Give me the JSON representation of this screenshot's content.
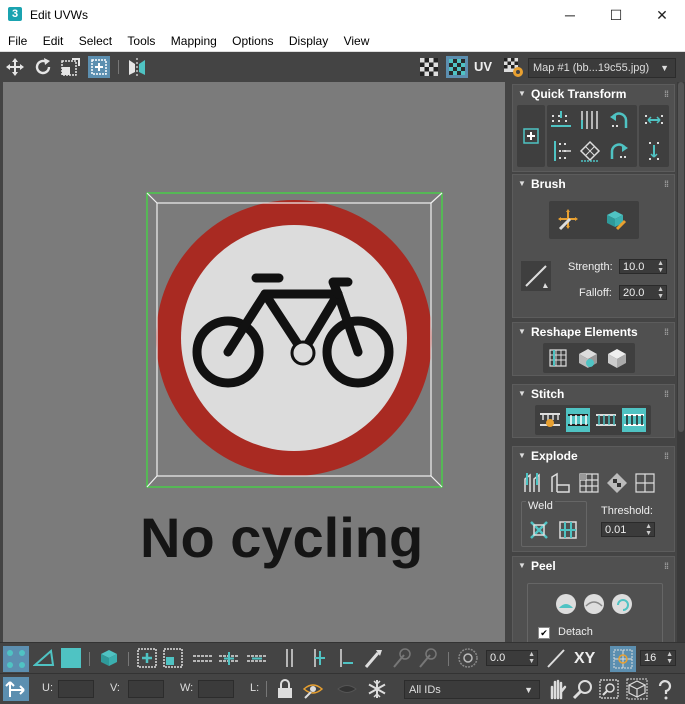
{
  "window": {
    "app_icon": "3",
    "title": "Edit UVWs",
    "minimize": "─",
    "maximize": "☐",
    "close": "✕"
  },
  "menu": [
    "File",
    "Edit",
    "Select",
    "Tools",
    "Mapping",
    "Options",
    "Display",
    "View"
  ],
  "toolbar": {
    "uv_label": "UV",
    "map_dropdown": "Map #1 (bb...19c55.jpg)"
  },
  "viewport": {
    "sign_text": "No cycling",
    "colors": {
      "sign_ring": "#a92a22",
      "background": "#7b7b7b",
      "selection": "#3ee03e"
    }
  },
  "panel": {
    "quick_transform": {
      "title": "Quick Transform"
    },
    "brush": {
      "title": "Brush",
      "strength_label": "Strength:",
      "strength_value": "10.0",
      "falloff_label": "Falloff:",
      "falloff_value": "20.0"
    },
    "reshape": {
      "title": "Reshape Elements"
    },
    "stitch": {
      "title": "Stitch"
    },
    "explode": {
      "title": "Explode",
      "weld_label": "Weld",
      "threshold_label": "Threshold:",
      "threshold_value": "0.01"
    },
    "peel": {
      "title": "Peel",
      "detach_label": "Detach",
      "detach_checked": true
    }
  },
  "bottom": {
    "offset_value": "0.0",
    "xy_label": "XY",
    "grid_value": "16",
    "u_label": "U:",
    "v_label": "V:",
    "w_label": "W:",
    "l_label": "L:",
    "ids_dropdown": "All IDs"
  }
}
